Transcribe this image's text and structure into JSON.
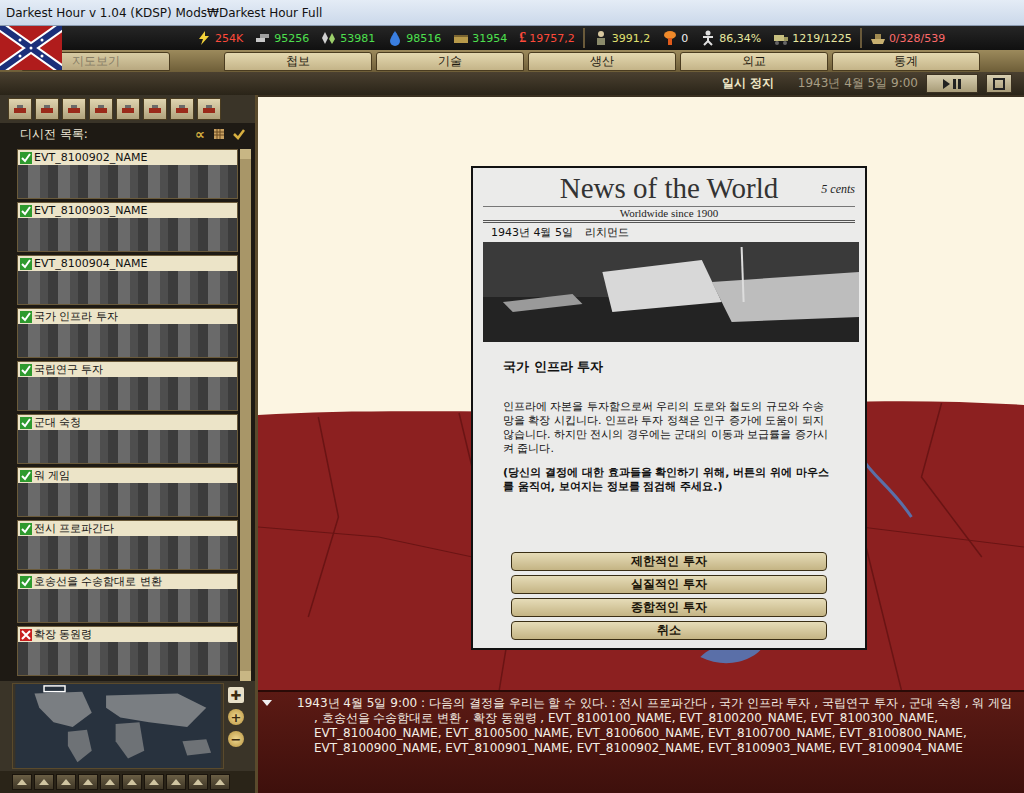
{
  "window": {
    "title": "Darkest Hour v 1.04 (KDSP)  Mods₩Darkest Hour Full"
  },
  "resource_groups": [
    [
      {
        "kind": "energy",
        "value": "254K",
        "color": "#ff4a3a"
      },
      {
        "kind": "metal",
        "value": "95256",
        "color": "#4ee04e"
      },
      {
        "kind": "rare",
        "value": "53981",
        "color": "#4ee04e"
      },
      {
        "kind": "oil",
        "value": "98516",
        "color": "#4ee04e"
      },
      {
        "kind": "supplies",
        "value": "31954",
        "color": "#4ee04e"
      },
      {
        "kind": "money",
        "glyph": "£",
        "value": "19757,2",
        "color": "#ff4a3a"
      }
    ],
    [
      {
        "kind": "manpower",
        "value": "3991,2",
        "color": "#e0e070"
      },
      {
        "kind": "nuclear",
        "value": "0",
        "color": "#f0f0f0"
      },
      {
        "kind": "unity",
        "value": "86,34%",
        "color": "#e8e8a0"
      },
      {
        "kind": "transport",
        "value": "1219/1225",
        "color": "#e8e8a0"
      }
    ],
    [
      {
        "kind": "convoy",
        "value": "0/328/539",
        "color": "#ff6a6a"
      }
    ]
  ],
  "tabs": [
    {
      "label": "지도보기",
      "selected": true
    },
    {
      "label": "첩보",
      "selected": false
    },
    {
      "label": "기술",
      "selected": false
    },
    {
      "label": "생산",
      "selected": false
    },
    {
      "label": "외교",
      "selected": false
    },
    {
      "label": "통계",
      "selected": false
    }
  ],
  "time": {
    "status": "일시 정지",
    "date": "1943년 4월 5일 9:00"
  },
  "sidebar": {
    "title": "디시전 목록:",
    "sort_glyph": "∝",
    "decisions": [
      {
        "name": "EVT_8100902_NAME",
        "available": true
      },
      {
        "name": "EVT_8100903_NAME",
        "available": true
      },
      {
        "name": "EVT_8100904_NAME",
        "available": true
      },
      {
        "name": "국가 인프라 투자",
        "available": true
      },
      {
        "name": "국립연구 투자",
        "available": true
      },
      {
        "name": "군대 숙청",
        "available": true
      },
      {
        "name": "워 게임",
        "available": true
      },
      {
        "name": "전시 프로파간다",
        "available": true
      },
      {
        "name": "호송선을 수송함대로 변환",
        "available": true
      },
      {
        "name": "확장 동원령",
        "available": false
      }
    ]
  },
  "minimap": {
    "buttons": [
      "✚",
      "+",
      "−"
    ]
  },
  "dialog": {
    "masthead": "News of the World",
    "price": "5 cents",
    "motto": "Worldwide since 1900",
    "date": "1943년 4월 5일",
    "place": "리치먼드",
    "title": "국가 인프라 투자",
    "body": "인프라에 자본을 투자함으로써 우리의 도로와 철도의 규모와 수송망을 확장 시킵니다. 인프라 투자 정책은 인구 증가에 도움이 되지 않습니다. 하지만 전시의 경우에는 군대의 이동과 보급률을 증가시켜 줍니다.",
    "hint": "(당신의 결정에 대한 효과들을 확인하기 위해, 버튼의 위에 마우스를 움직여, 보여지는 정보를 점검해 주세요.)",
    "buttons": [
      "제한적인 투자",
      "실질적인 투자",
      "종합적인 투자",
      "취소"
    ]
  },
  "log": {
    "text": "1943년 4월 5일 9:00 : 다음의 결정을 우리는 할 수 있다. : 전시 프로파간다 , 국가 인프라 투자 , 국립연구 투자 , 군대 숙청 , 워 게임 , 호송선을 수송함대로 변환 , 확장 동원령 , EVT_8100100_NAME, EVT_8100200_NAME, EVT_8100300_NAME, EVT_8100400_NAME, EVT_8100500_NAME, EVT_8100600_NAME, EVT_8100700_NAME, EVT_8100800_NAME, EVT_8100900_NAME, EVT_8100901_NAME, EVT_8100902_NAME, EVT_8100903_NAME, EVT_8100904_NAME"
  }
}
